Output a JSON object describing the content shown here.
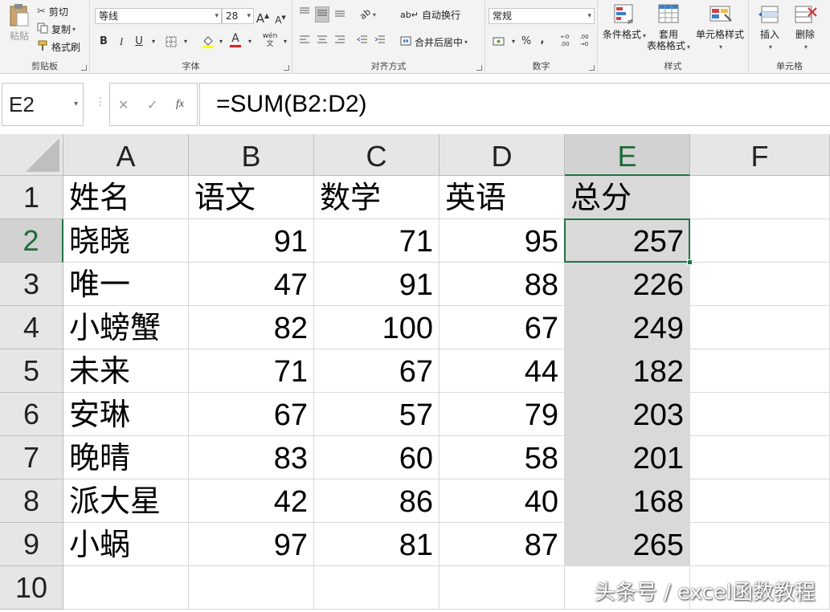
{
  "ribbon": {
    "clipboard": {
      "paste": "粘贴",
      "cut": "剪切",
      "copy": "复制",
      "format_painter": "格式刷",
      "label": "剪贴板"
    },
    "font": {
      "name": "等线",
      "size": "28",
      "bold": "B",
      "italic": "I",
      "underline": "U",
      "grow": "A",
      "shrink": "A",
      "label": "字体"
    },
    "alignment": {
      "wrap": "自动换行",
      "merge": "合并后居中",
      "label": "对齐方式"
    },
    "number": {
      "format": "常规",
      "percent": "%",
      "comma": ",",
      "inc": "←0 .00",
      "dec": ".00 →0",
      "label": "数字"
    },
    "styles": {
      "conditional": "条件格式",
      "table1": "套用",
      "table2": "表格格式",
      "cell_styles": "单元格样式",
      "label": "样式"
    },
    "cells": {
      "insert": "插入",
      "delete": "删除",
      "label": "单元格"
    }
  },
  "formula_bar": {
    "name_box": "E2",
    "cancel": "✕",
    "enter": "✓",
    "fx": "fx",
    "formula": "=SUM(B2:D2)"
  },
  "columns": [
    "A",
    "B",
    "C",
    "D",
    "E",
    "F"
  ],
  "row_numbers": [
    "1",
    "2",
    "3",
    "4",
    "5",
    "6",
    "7",
    "8",
    "9",
    "10"
  ],
  "header_row": [
    "姓名",
    "语文",
    "数学",
    "英语",
    "总分"
  ],
  "rows": [
    [
      "晓晓",
      "91",
      "71",
      "95",
      "257"
    ],
    [
      "唯一",
      "47",
      "91",
      "88",
      "226"
    ],
    [
      "小螃蟹",
      "82",
      "100",
      "67",
      "249"
    ],
    [
      "未来",
      "71",
      "67",
      "44",
      "182"
    ],
    [
      "安琳",
      "67",
      "57",
      "79",
      "203"
    ],
    [
      "晚晴",
      "83",
      "60",
      "58",
      "201"
    ],
    [
      "派大星",
      "42",
      "86",
      "40",
      "168"
    ],
    [
      "小蜗",
      "97",
      "81",
      "87",
      "265"
    ]
  ],
  "watermark": "头条号 / excel函数教程",
  "colors": {
    "accent": "#217346",
    "selected_fill": "#d9d9d9"
  }
}
